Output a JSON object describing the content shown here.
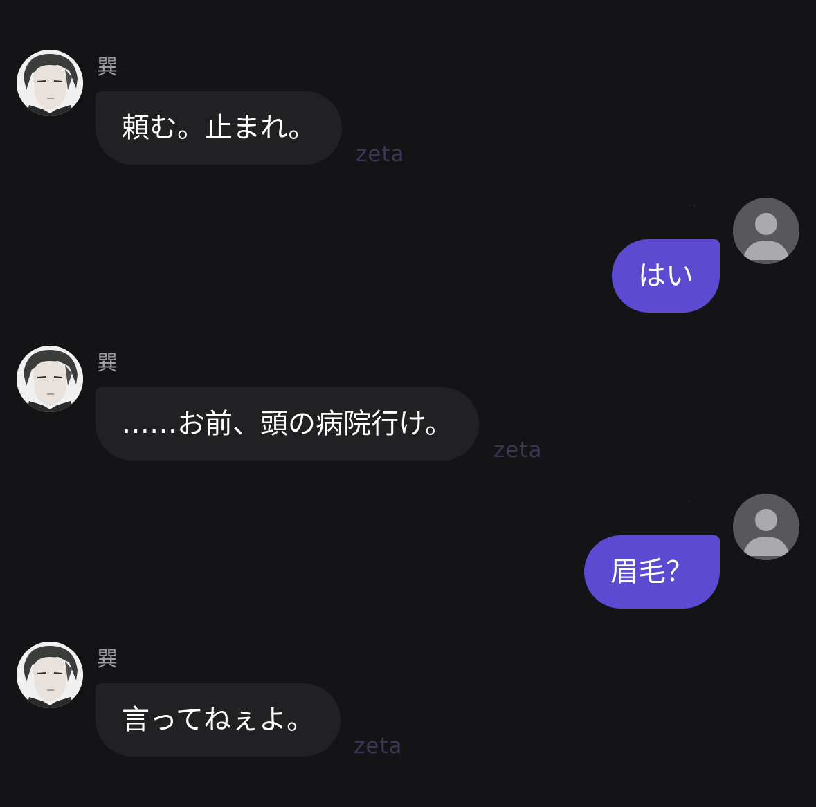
{
  "bot": {
    "name": "巽",
    "watermark": "zeta"
  },
  "messages": [
    {
      "role": "bot",
      "text": "頼む。止まれ。"
    },
    {
      "role": "user",
      "text": "はい"
    },
    {
      "role": "bot",
      "text": "……お前、頭の病院行け。"
    },
    {
      "role": "user",
      "text": "眉毛？"
    },
    {
      "role": "bot",
      "text": "言ってねぇよ。"
    }
  ],
  "colors": {
    "background": "#141416",
    "bot_bubble": "#212124",
    "user_bubble": "#5c4bd0",
    "watermark": "#3a3654"
  }
}
